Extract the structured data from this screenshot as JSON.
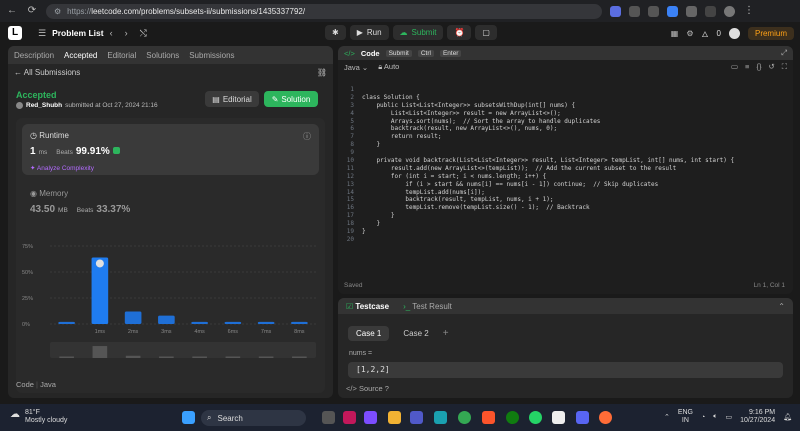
{
  "browser": {
    "url_proto": "https://",
    "url_rest": "leetcode.com/problems/subsets-ii/submissions/1435337792/"
  },
  "topbar": {
    "problem_list": "Problem List",
    "run": "Run",
    "submit": "Submit",
    "premium": "Premium",
    "notif_count": "0"
  },
  "left": {
    "tabs": [
      "Description",
      "Accepted",
      "Editorial",
      "Solutions",
      "Submissions"
    ],
    "all_submissions": "All Submissions",
    "status": "Accepted",
    "user": "Red_Shubh",
    "submitted_at": "submitted at Oct 27, 2024 21:16",
    "editorial_btn": "Editorial",
    "solution_btn": "Solution",
    "runtime_title": "Runtime",
    "runtime_value": "1",
    "runtime_unit": "ms",
    "beats_label": "Beats",
    "runtime_beats": "99.91%",
    "analyze": "Analyze Complexity",
    "memory_title": "Memory",
    "memory_value": "43.50",
    "memory_unit": "MB",
    "memory_beats": "33.37%",
    "code_label": "Code",
    "code_lang": "Java"
  },
  "chart_data": {
    "type": "bar",
    "categories": [
      "",
      "1ms",
      "2ms",
      "3ms",
      "4ms",
      "6ms",
      "7ms",
      "8ms"
    ],
    "values": [
      2,
      64,
      12,
      8,
      2,
      2,
      2,
      2
    ],
    "highlight_index": 1,
    "yticks": [
      "75%",
      "50%",
      "25%",
      "0%"
    ],
    "ylim": [
      0,
      75
    ]
  },
  "editor": {
    "title": "Code",
    "kbd": [
      "Submit",
      "Ctrl",
      "Enter"
    ],
    "lang": "Java",
    "mode": "Auto",
    "lines": [
      "",
      "class Solution {",
      "    public List<List<Integer>> subsetsWithDup(int[] nums) {",
      "        List<List<Integer>> result = new ArrayList<>();",
      "        Arrays.sort(nums);  // Sort the array to handle duplicates",
      "        backtrack(result, new ArrayList<>(), nums, 0);",
      "        return result;",
      "    }",
      "",
      "    private void backtrack(List<List<Integer>> result, List<Integer> tempList, int[] nums, int start) {",
      "        result.add(new ArrayList<>(tempList));  // Add the current subset to the result",
      "        for (int i = start; i < nums.length; i++) {",
      "            if (i > start && nums[i] == nums[i - 1]) continue;  // Skip duplicates",
      "            tempList.add(nums[i]);",
      "            backtrack(result, tempList, nums, i + 1);",
      "            tempList.remove(tempList.size() - 1);  // Backtrack",
      "        }",
      "    }",
      "}",
      ""
    ],
    "saved": "Saved",
    "position": "Ln 1, Col 1"
  },
  "testcase": {
    "tab": "Testcase",
    "result_tab": "Test Result",
    "cases": [
      "Case 1",
      "Case 2"
    ],
    "param_label": "nums =",
    "param_value": "[1,2,2]",
    "source": "Source"
  },
  "taskbar": {
    "temp": "81°F",
    "weather": "Mostly cloudy",
    "search": "Search",
    "lang1": "ENG",
    "lang2": "IN",
    "time": "9:16 PM",
    "date": "10/27/2024"
  }
}
